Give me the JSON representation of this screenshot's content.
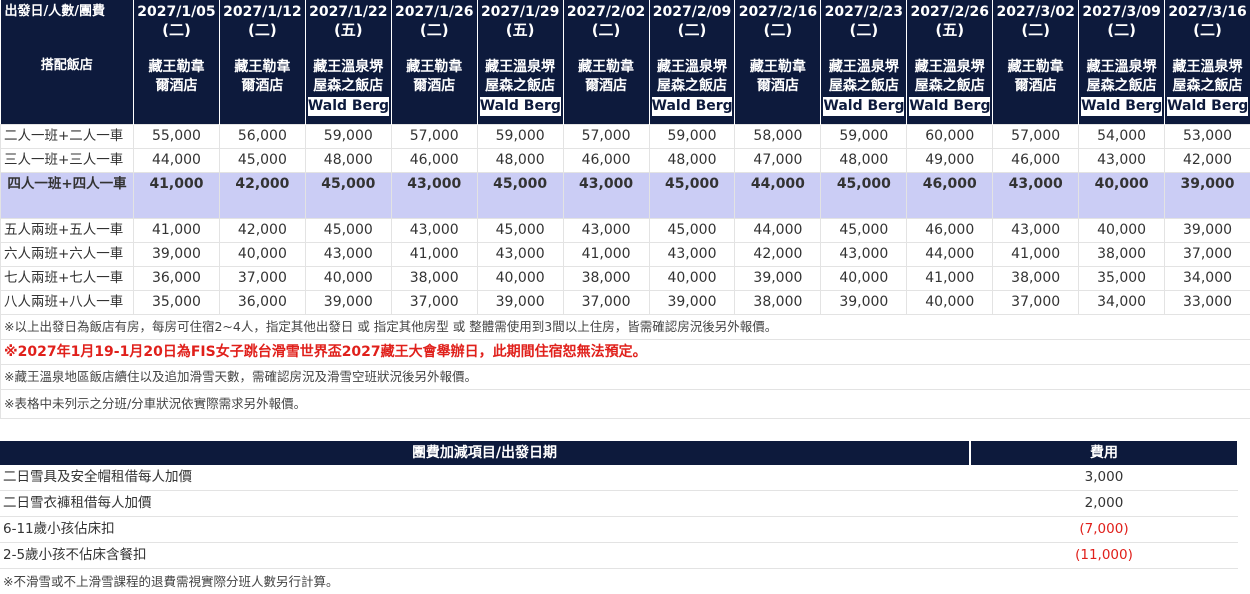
{
  "price_table": {
    "corner_label": "出發日/人數/團費",
    "hotel_label": "搭配飯店",
    "columns": [
      {
        "date": "2027/1/05",
        "weekday": "(二)",
        "hotel": [
          "藏王勒韋",
          "爾酒店"
        ]
      },
      {
        "date": "2027/1/12",
        "weekday": "(二)",
        "hotel": [
          "藏王勒韋",
          "爾酒店"
        ]
      },
      {
        "date": "2027/1/22",
        "weekday": "(五)",
        "hotel": [
          "藏王溫泉堺",
          "屋森之飯店",
          "Wald Berg"
        ]
      },
      {
        "date": "2027/1/26",
        "weekday": "(二)",
        "hotel": [
          "藏王勒韋",
          "爾酒店"
        ]
      },
      {
        "date": "2027/1/29",
        "weekday": "(五)",
        "hotel": [
          "藏王溫泉堺",
          "屋森之飯店",
          "Wald Berg"
        ]
      },
      {
        "date": "2027/2/02",
        "weekday": "(二)",
        "hotel": [
          "藏王勒韋",
          "爾酒店"
        ]
      },
      {
        "date": "2027/2/09",
        "weekday": "(二)",
        "hotel": [
          "藏王溫泉堺",
          "屋森之飯店",
          "Wald Berg"
        ]
      },
      {
        "date": "2027/2/16",
        "weekday": "(二)",
        "hotel": [
          "藏王勒韋",
          "爾酒店"
        ]
      },
      {
        "date": "2027/2/23",
        "weekday": "(二)",
        "hotel": [
          "藏王溫泉堺",
          "屋森之飯店",
          "Wald Berg"
        ]
      },
      {
        "date": "2027/2/26",
        "weekday": "(五)",
        "hotel": [
          "藏王溫泉堺",
          "屋森之飯店",
          "Wald Berg"
        ]
      },
      {
        "date": "2027/3/02",
        "weekday": "(二)",
        "hotel": [
          "藏王勒韋",
          "爾酒店"
        ]
      },
      {
        "date": "2027/3/09",
        "weekday": "(二)",
        "hotel": [
          "藏王溫泉堺",
          "屋森之飯店",
          "Wald Berg"
        ]
      },
      {
        "date": "2027/3/16",
        "weekday": "(二)",
        "hotel": [
          "藏王溫泉堺",
          "屋森之飯店",
          "Wald Berg"
        ]
      }
    ],
    "rows": [
      {
        "label": "二人一班+二人一車",
        "highlight": false,
        "values": [
          "55,000",
          "56,000",
          "59,000",
          "57,000",
          "59,000",
          "57,000",
          "59,000",
          "58,000",
          "59,000",
          "60,000",
          "57,000",
          "54,000",
          "53,000"
        ]
      },
      {
        "label": "三人一班+三人一車",
        "highlight": false,
        "values": [
          "44,000",
          "45,000",
          "48,000",
          "46,000",
          "48,000",
          "46,000",
          "48,000",
          "47,000",
          "48,000",
          "49,000",
          "46,000",
          "43,000",
          "42,000"
        ]
      },
      {
        "label": "四人一班+四人一車",
        "highlight": true,
        "values": [
          "41,000",
          "42,000",
          "45,000",
          "43,000",
          "45,000",
          "43,000",
          "45,000",
          "44,000",
          "45,000",
          "46,000",
          "43,000",
          "40,000",
          "39,000"
        ]
      },
      {
        "label": "五人兩班+五人一車",
        "highlight": false,
        "values": [
          "41,000",
          "42,000",
          "45,000",
          "43,000",
          "45,000",
          "43,000",
          "45,000",
          "44,000",
          "45,000",
          "46,000",
          "43,000",
          "40,000",
          "39,000"
        ]
      },
      {
        "label": "六人兩班+六人一車",
        "highlight": false,
        "values": [
          "39,000",
          "40,000",
          "43,000",
          "41,000",
          "43,000",
          "41,000",
          "43,000",
          "42,000",
          "43,000",
          "44,000",
          "41,000",
          "38,000",
          "37,000"
        ]
      },
      {
        "label": "七人兩班+七人一車",
        "highlight": false,
        "values": [
          "36,000",
          "37,000",
          "40,000",
          "38,000",
          "40,000",
          "38,000",
          "40,000",
          "39,000",
          "40,000",
          "41,000",
          "38,000",
          "35,000",
          "34,000"
        ]
      },
      {
        "label": "八人兩班+八人一車",
        "highlight": false,
        "values": [
          "35,000",
          "36,000",
          "39,000",
          "37,000",
          "39,000",
          "37,000",
          "39,000",
          "38,000",
          "39,000",
          "40,000",
          "37,000",
          "34,000",
          "33,000"
        ]
      }
    ],
    "notes": [
      {
        "text": "※以上出發日為飯店有房，每房可住宿2~4人，指定其他出發日 或 指定其他房型 或 整體需使用到3間以上住房，皆需確認房況後另外報價。",
        "red": false
      },
      {
        "text": "※2027年1月19-1月20日為FIS女子跳台滑雪世界盃2027藏王大會舉辦日，此期間住宿恕無法預定。",
        "red": true
      },
      {
        "text": "※藏王溫泉地區飯店續住以及追加滑雪天數，需確認房況及滑雪空班狀況後另外報價。",
        "red": false
      },
      {
        "text": "※表格中未列示之分班/分車狀況依實際需求另外報價。",
        "red": false
      }
    ]
  },
  "addon_table": {
    "item_header": "團費加減項目/出發日期",
    "fee_header": "費用",
    "rows": [
      {
        "item": "二日雪具及安全帽租借每人加價",
        "fee": "3,000",
        "negative": false
      },
      {
        "item": "二日雪衣褲租借每人加價",
        "fee": "2,000",
        "negative": false
      },
      {
        "item": "6-11歲小孩佔床扣",
        "fee": "(7,000)",
        "negative": true
      },
      {
        "item": "2-5歲小孩不佔床含餐扣",
        "fee": "(11,000)",
        "negative": true
      }
    ],
    "note": "※不滑雪或不上滑雪課程的退費需視實際分班人數另行計算。"
  },
  "colors": {
    "header_bg": "#0d1a3c",
    "highlight_row": "#cbcdf5",
    "red_text": "#e0201b"
  }
}
